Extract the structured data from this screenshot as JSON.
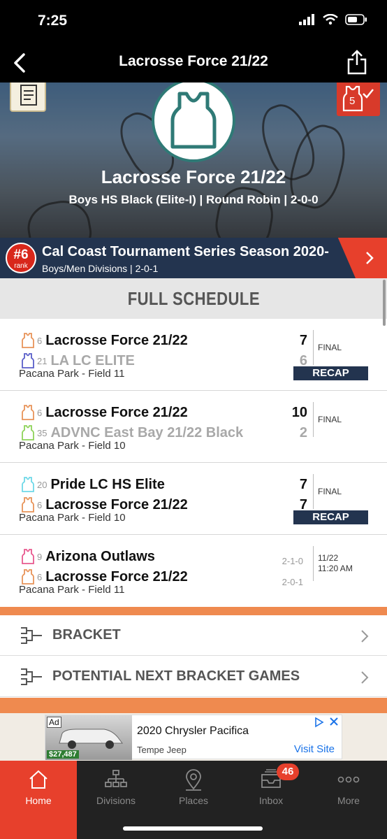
{
  "status_bar": {
    "time": "7:25"
  },
  "navbar": {
    "title": "Lacrosse Force 21/22"
  },
  "team": {
    "name": "Lacrosse Force 21/22",
    "subtitle": "Boys HS Black (Elite-I) | Round Robin | 2-0-0",
    "badge_count": "5"
  },
  "tournament": {
    "rank": "#6",
    "rank_label": "rank",
    "title": "Cal Coast Tournament Series Season 2020-",
    "subtitle": "Boys/Men Divisions | 2-0-1"
  },
  "schedule": {
    "heading": "FULL SCHEDULE",
    "games": [
      {
        "team1": {
          "seed": "6",
          "name": "Lacrosse Force 21/22",
          "score": "7",
          "jersey_color": "#e8945a",
          "dim": false
        },
        "team2": {
          "seed": "21",
          "name": "LA LC ELITE",
          "score": "6",
          "jersey_color": "#5a5fc9",
          "dim": true
        },
        "status": "FINAL",
        "recap": "RECAP",
        "location": "Pacana Park - Field 11"
      },
      {
        "team1": {
          "seed": "6",
          "name": "Lacrosse Force 21/22",
          "score": "10",
          "jersey_color": "#e8945a",
          "dim": false
        },
        "team2": {
          "seed": "35",
          "name": "ADVNC East Bay 21/22 Black",
          "score": "2",
          "jersey_color": "#8fd35a",
          "dim": true
        },
        "status": "FINAL",
        "location": "Pacana Park - Field 10"
      },
      {
        "team1": {
          "seed": "20",
          "name": "Pride LC HS Elite",
          "score": "7",
          "jersey_color": "#6ed8e8",
          "dim": false
        },
        "team2": {
          "seed": "6",
          "name": "Lacrosse Force 21/22",
          "score": "7",
          "jersey_color": "#e8945a",
          "dim": false
        },
        "status": "FINAL",
        "recap": "RECAP",
        "location": "Pacana Park - Field 10"
      },
      {
        "team1": {
          "seed": "9",
          "name": "Arizona Outlaws",
          "record": "2-1-0",
          "jersey_color": "#e85a8f",
          "dim": false
        },
        "team2": {
          "seed": "6",
          "name": "Lacrosse Force 21/22",
          "record": "2-0-1",
          "jersey_color": "#e8945a",
          "dim": false
        },
        "date": "11/22",
        "time": "11:20 AM",
        "location": "Pacana Park - Field 11"
      }
    ]
  },
  "links": {
    "bracket": "BRACKET",
    "potential": "POTENTIAL NEXT BRACKET GAMES"
  },
  "ad": {
    "tag": "Ad",
    "price": "$27,487",
    "headline": "2020 Chrysler Pacifica",
    "advertiser": "Tempe Jeep",
    "cta": "Visit Site"
  },
  "tabs": [
    {
      "label": "Home",
      "icon": "home-icon"
    },
    {
      "label": "Divisions",
      "icon": "divisions-icon"
    },
    {
      "label": "Places",
      "icon": "places-icon"
    },
    {
      "label": "Inbox",
      "icon": "inbox-icon",
      "badge": "46"
    },
    {
      "label": "More",
      "icon": "more-icon"
    }
  ],
  "colors": {
    "accent": "#e7402c",
    "navy": "#23344f",
    "orange": "#ef8a4f",
    "team_teal": "#2f7a76"
  }
}
